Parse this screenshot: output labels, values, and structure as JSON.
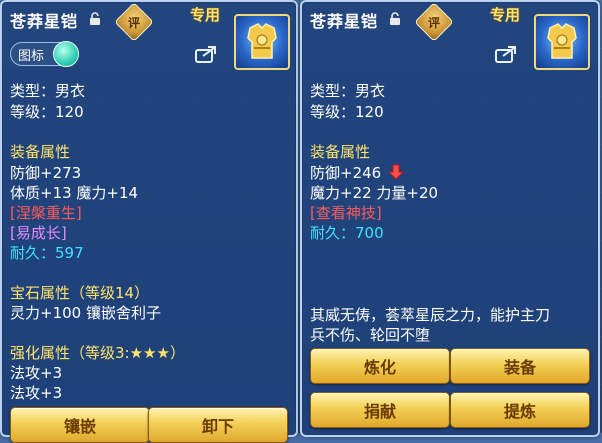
{
  "left_panel": {
    "title": "苍莽星铠",
    "rate_badge": "评",
    "exclusive": "专用",
    "toggle_label": "图标",
    "type": "类型：男衣",
    "level": "等级：120",
    "attr_header": "装备属性",
    "defense": "防御+273",
    "stats": "体质+13 魔力+14",
    "nirvana": "[涅槃重生]",
    "easy_grow": "[易成长]",
    "durability_label": "耐久：",
    "durability_value": "597",
    "gem_header": "宝石属性（等级14）",
    "gem_line": "灵力+100 镶嵌舍利子",
    "enhance_header": "强化属性（等级3:★★★）",
    "enhance_1": "法攻+3",
    "enhance_2": "法攻+3",
    "btn_inlay": "镶嵌",
    "btn_unequip": "卸下"
  },
  "right_panel": {
    "title": "苍莽星铠",
    "rate_badge": "评",
    "exclusive": "专用",
    "type": "类型：男衣",
    "level": "等级：120",
    "attr_header": "装备属性",
    "defense": "防御+246",
    "stats": "魔力+22 力量+20",
    "view_skill": "[查看神技]",
    "durability_label": "耐久：",
    "durability_value": "700",
    "desc_1": "其威无俦，荟萃星辰之力，能护主刀",
    "desc_2": "兵不伤、轮回不堕",
    "btn_refine": "炼化",
    "btn_equip": "装备",
    "btn_donate": "捐献",
    "btn_extract": "提炼"
  },
  "icons": [
    "lock-icon",
    "share-icon",
    "armor-icon",
    "down-arrow-icon"
  ],
  "colors": {
    "gold": "#ffe36a",
    "red": "#ff5a5a",
    "violet": "#e58cff",
    "cyan": "#3fe1ff",
    "panel": "#1c4078",
    "button": "#f3cf56"
  }
}
